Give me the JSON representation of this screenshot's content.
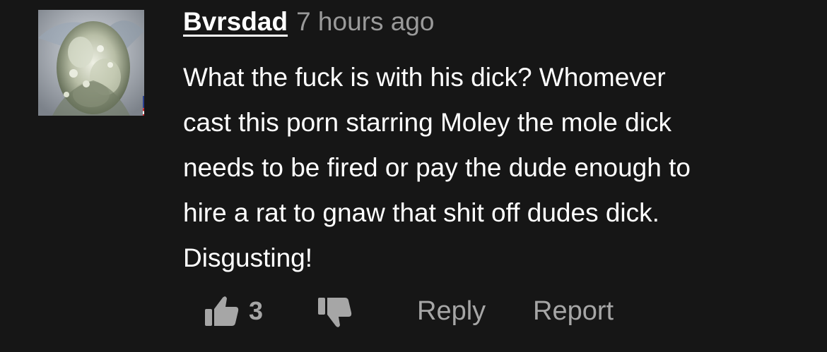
{
  "comment": {
    "username": "Bvrsdad",
    "timestamp": "7 hours ago",
    "body_lines": [
      "What the fuck is with his dick? Whomever",
      "cast this porn starring Moley the mole dick",
      "needs to be fired or pay the dude enough to",
      "hire a rat to gnaw that shit off dudes dick.",
      "Disgusting!"
    ],
    "likes": "3",
    "reply_label": "Reply",
    "report_label": "Report"
  },
  "icons": {
    "like": "thumbs-up-icon",
    "dislike": "thumbs-down-icon",
    "flag": "us-flag-icon"
  },
  "colors": {
    "background": "#161616",
    "text": "#ffffff",
    "muted": "#a6a6a6"
  }
}
